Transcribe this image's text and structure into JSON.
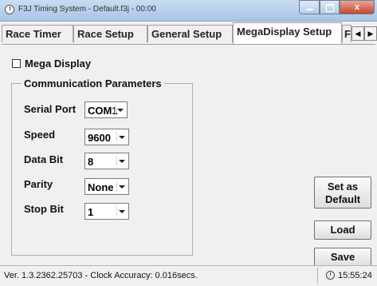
{
  "window": {
    "title": "F3J Timing System - Default.f3j - 00:00",
    "close_label": "x",
    "icons": {
      "app": "clock-icon",
      "minimize": "minimize-icon",
      "maximize": "maximize-icon",
      "close": "close-icon"
    }
  },
  "tabs": [
    {
      "label": "Race Timer",
      "active": false
    },
    {
      "label": "Race Setup",
      "active": false
    },
    {
      "label": "General Setup",
      "active": false
    },
    {
      "label": "MegaDisplay Setup",
      "active": true
    },
    {
      "label": "F",
      "active": false
    }
  ],
  "tab_scroll": {
    "left": "◀",
    "right": "▶"
  },
  "mega_display": {
    "label": "Mega Display",
    "checked": false
  },
  "comm_params": {
    "title": "Communication Parameters",
    "fields": [
      {
        "label": "Serial Port",
        "value": "COM1"
      },
      {
        "label": "Speed",
        "value": "9600"
      },
      {
        "label": "Data Bit",
        "value": "8"
      },
      {
        "label": "Parity",
        "value": "None"
      },
      {
        "label": "Stop Bit",
        "value": "1"
      }
    ]
  },
  "buttons": {
    "set_default_line1": "Set as",
    "set_default_line2": "Default",
    "load": "Load",
    "save": "Save"
  },
  "statusbar": {
    "version_text": "Ver. 1.3.2362.25703 - Clock Accuracy: 0.016secs.",
    "time": "15:55:24"
  },
  "colors": {
    "accent": "#a9c4e6",
    "close": "#c8442f"
  }
}
